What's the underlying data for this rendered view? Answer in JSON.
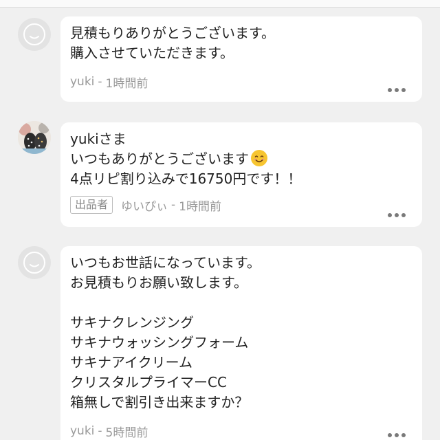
{
  "comments": [
    {
      "avatar_icon": "default-face-icon",
      "lines": [
        "見積もりありがとうございます。",
        "購入させていただきます。"
      ],
      "author": "yuki",
      "separator": "-",
      "time": "1時間前"
    },
    {
      "avatar_icon": "photo-avatar",
      "lines": [
        "yukiさま",
        "いつもありがとうございます",
        "4点リピ割り込みで16750円です！！"
      ],
      "emoji": "smiling-face-emoji",
      "badge": "出品者",
      "author": "ゆいぴぃ",
      "separator": "-",
      "time": "1時間前"
    },
    {
      "avatar_icon": "default-face-icon",
      "lines": [
        "いつもお世話になっています。",
        "お見積もりお願い致します。",
        "",
        "サキナクレンジング",
        "サキナウォッシングフォーム",
        "サキナアイクリーム",
        "クリスタルプライマーCC",
        "箱無しで割引き出来ますか？"
      ],
      "author": "yuki",
      "separator": "-",
      "time": "5時間前"
    }
  ],
  "colors": {
    "background": "#f0f0f0",
    "bubble": "#ffffff",
    "text": "#222222",
    "meta": "#9a9a9a"
  }
}
